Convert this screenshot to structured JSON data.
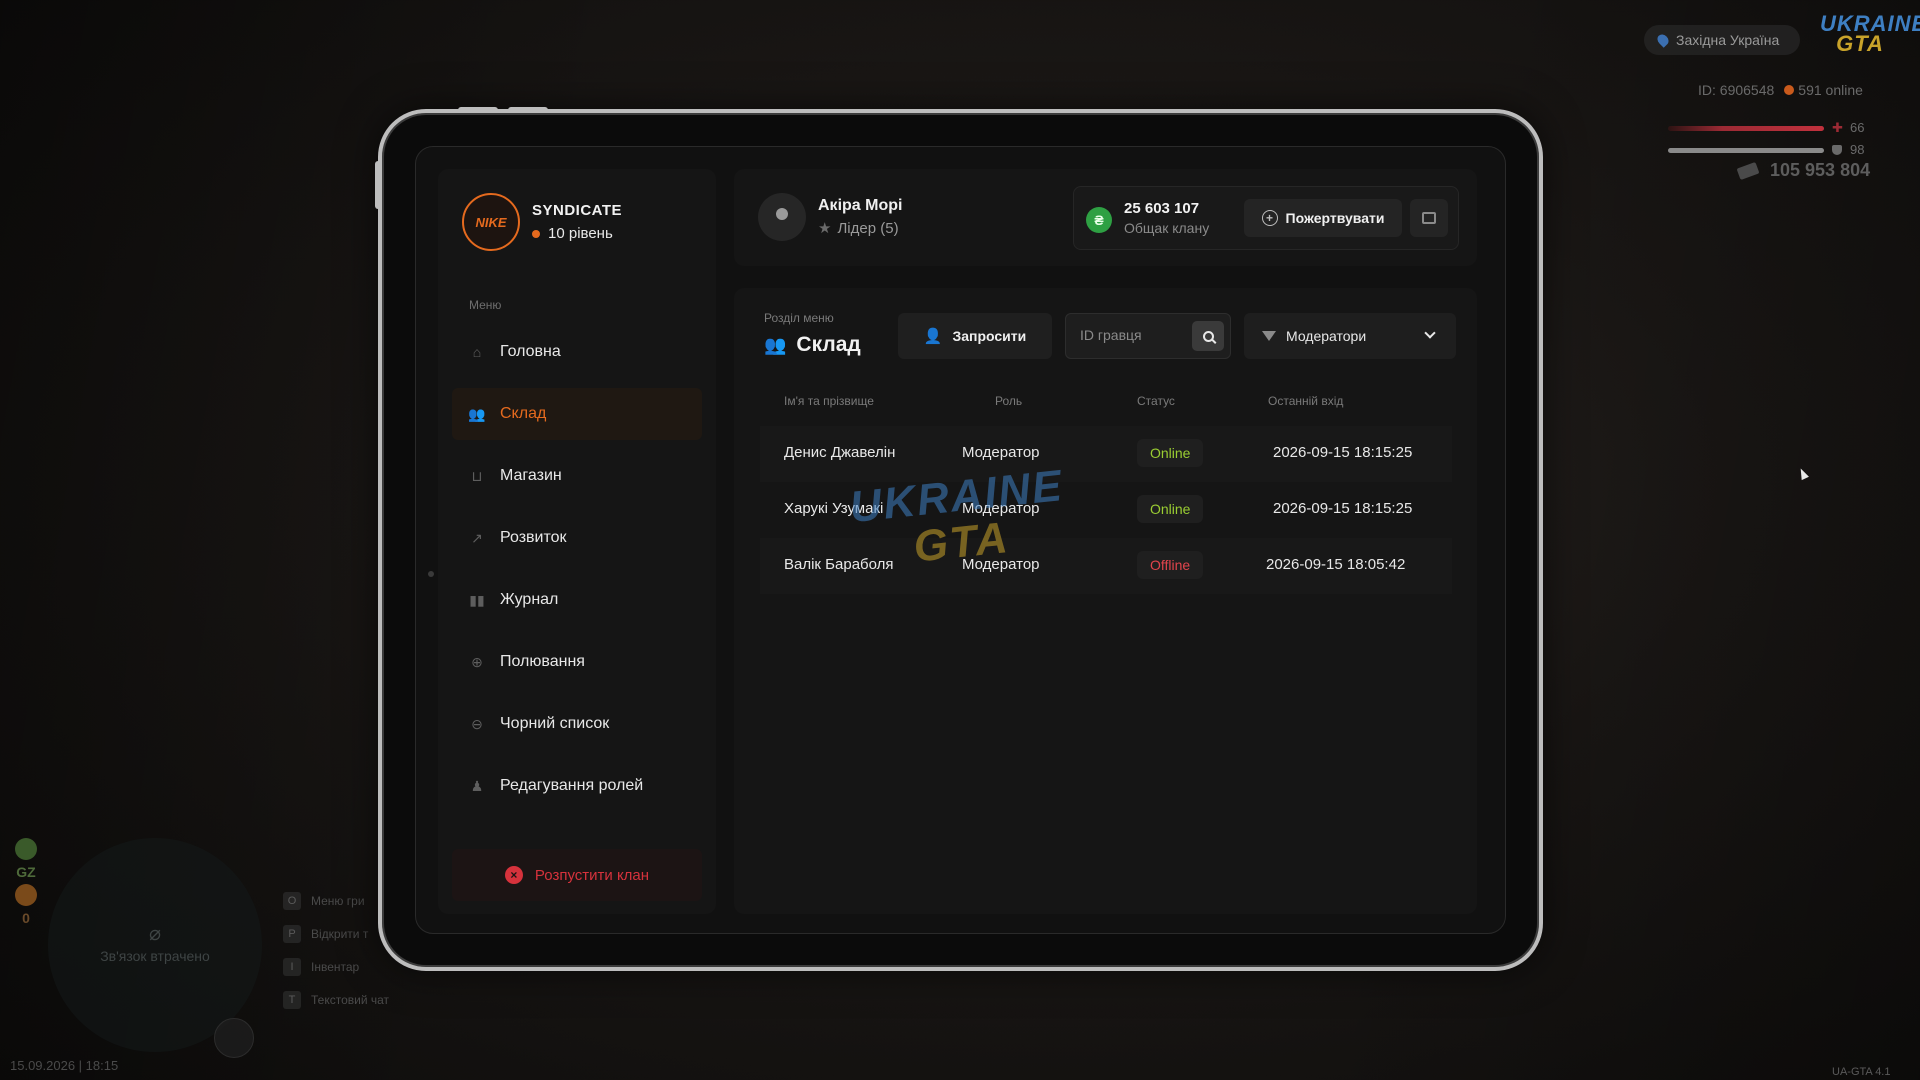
{
  "hud": {
    "region": "Західна Україна",
    "logo_top": "UKRAINE",
    "logo_bottom": "GTA",
    "player_id": "ID: 6906548",
    "online": "591 online",
    "health": "66",
    "armor": "98",
    "money": "105 953 804",
    "gz_label": "GZ",
    "kills": "0",
    "radar_text": "Зв'язок втрачено",
    "datetime": "15.09.2026 | 18:15",
    "version": "UA-GTA 4.1",
    "key_hints": [
      {
        "key": "O",
        "label": "Меню гри"
      },
      {
        "key": "P",
        "label": "Відкрити т"
      },
      {
        "key": "I",
        "label": "Інвентар"
      },
      {
        "key": "T",
        "label": "Текстовий чат"
      }
    ]
  },
  "clan": {
    "logo_text": "NIKE",
    "name": "SYNDICATE",
    "level": "10 рівень"
  },
  "sidebar": {
    "menu_title": "Меню",
    "items": [
      {
        "label": "Головна",
        "icon": "home-icon"
      },
      {
        "label": "Склад",
        "icon": "people-icon",
        "active": true
      },
      {
        "label": "Магазин",
        "icon": "basket-icon"
      },
      {
        "label": "Розвиток",
        "icon": "chart-icon"
      },
      {
        "label": "Журнал",
        "icon": "book-icon"
      },
      {
        "label": "Полювання",
        "icon": "crosshair-icon"
      },
      {
        "label": "Чорний список",
        "icon": "blocked-icon"
      },
      {
        "label": "Редагування ролей",
        "icon": "user-edit-icon"
      }
    ],
    "disband_label": "Розпустити клан"
  },
  "header": {
    "user_name": "Акіра Морі",
    "user_role": "Лідер (5)",
    "bank_amount": "25 603 107",
    "bank_label": "Общак клану",
    "donate_label": "Пожертвувати"
  },
  "content": {
    "section_label": "Розділ меню",
    "section_title": "Склад",
    "invite_label": "Запросити",
    "search_placeholder": "ID гравця",
    "filter_value": "Модератори",
    "columns": [
      "Ім'я та прізвище",
      "Роль",
      "Статус",
      "Останній вхід"
    ],
    "rows": [
      {
        "name": "Денис Джавелін",
        "role": "Модератор",
        "status": "Online",
        "last": "2026-09-15 18:15:25"
      },
      {
        "name": "Харукі Узумакі",
        "role": "Модератор",
        "status": "Online",
        "last": "2026-09-15 18:15:25"
      },
      {
        "name": "Валік Бараболя",
        "role": "Модератор",
        "status": "Offline",
        "last": "2026-09-15 18:05:42"
      }
    ],
    "watermark_top": "UKRAINE",
    "watermark_bottom": "GTA"
  },
  "colors": {
    "accent": "#e56a1e",
    "online": "#9acd32",
    "offline": "#e0444c",
    "danger": "#d6323c",
    "money": "#2ea043"
  }
}
